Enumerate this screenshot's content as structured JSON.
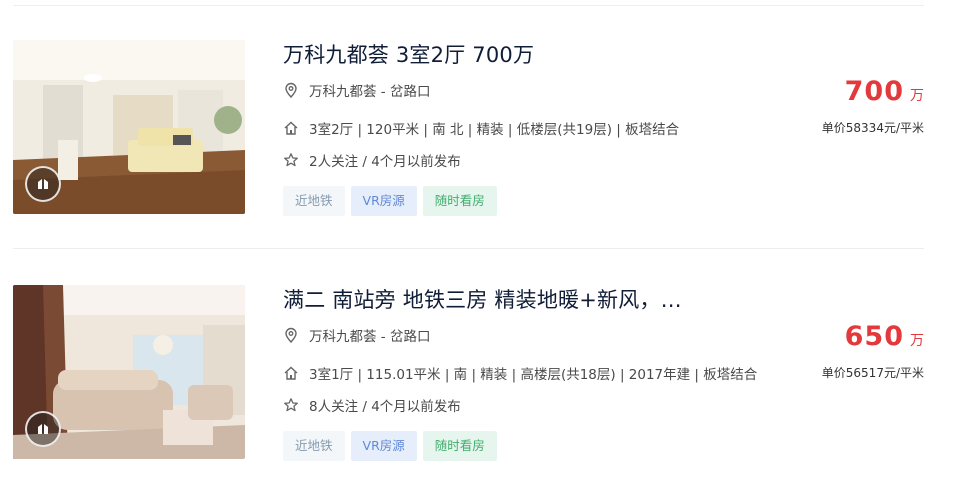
{
  "listings": [
    {
      "title": "万科九都荟 3室2厅 700万",
      "address": "万科九都荟 - 岔路口",
      "house_info": "3室2厅 | 120平米 | 南 北 | 精装 | 低楼层(共19层) | 板塔结合",
      "follow_info": "2人关注 / 4个月以前发布",
      "tags": [
        "近地铁",
        "VR房源",
        "随时看房"
      ],
      "total_price": "700",
      "total_unit": "万",
      "unit_price": "单价58334元/平米"
    },
    {
      "title": "满二 南站旁 地铁三房 精装地暖+新风，…",
      "address": "万科九都荟 - 岔路口",
      "house_info": "3室1厅 | 115.01平米 | 南 | 精装 | 高楼层(共18层) | 2017年建 | 板塔结合",
      "follow_info": "8人关注 / 4个月以前发布",
      "tags": [
        "近地铁",
        "VR房源",
        "随时看房"
      ],
      "total_price": "650",
      "total_unit": "万",
      "unit_price": "单价56517元/平米"
    }
  ],
  "icons": {
    "address": "location-pin-icon",
    "house": "house-icon",
    "follow": "star-icon",
    "vr": "vr-badge-icon"
  },
  "colors": {
    "price": "#e4393c",
    "title": "#101d37"
  }
}
